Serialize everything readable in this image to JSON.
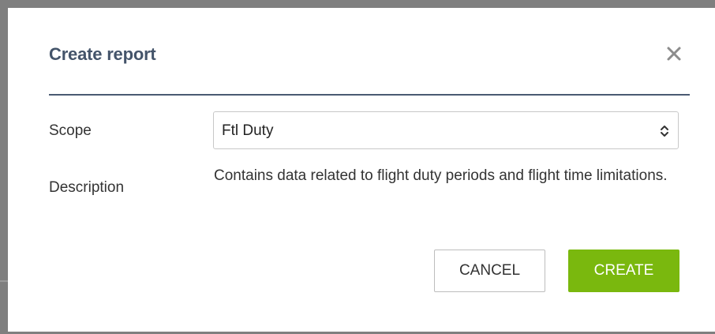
{
  "dialog": {
    "title": "Create report",
    "close_icon": "close-icon",
    "scope": {
      "label": "Scope",
      "selected_value": "Ftl Duty",
      "arrows_icon": "updown-chevron-icon"
    },
    "description": {
      "label": "Description",
      "text": "Contains data related to flight duty periods and flight time limitations."
    },
    "buttons": {
      "cancel_label": "CANCEL",
      "create_label": "CREATE"
    }
  },
  "colors": {
    "title": "#44546a",
    "header_rule": "#4a5a72",
    "create_button": "#7ab80e",
    "backdrop": "#7f7f7f"
  }
}
